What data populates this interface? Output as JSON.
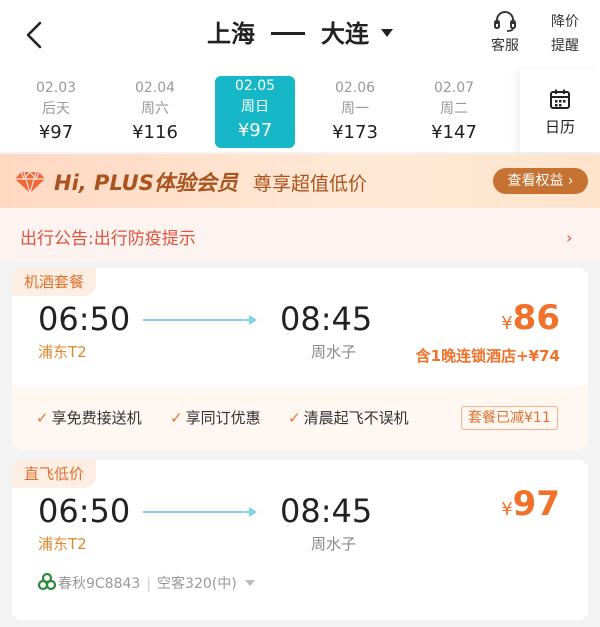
{
  "header": {
    "origin": "上海",
    "destination": "大连",
    "service_label": "客服",
    "alert_line1": "降价",
    "alert_line2": "提醒"
  },
  "dates": [
    {
      "date": "02.03",
      "weekday": "后天",
      "price": "¥97",
      "selected": false
    },
    {
      "date": "02.04",
      "weekday": "周六",
      "price": "¥116",
      "selected": false
    },
    {
      "date": "02.05",
      "weekday": "周日",
      "price": "¥97",
      "selected": true
    },
    {
      "date": "02.06",
      "weekday": "周一",
      "price": "¥173",
      "selected": false
    },
    {
      "date": "02.07",
      "weekday": "周二",
      "price": "¥147",
      "selected": false
    }
  ],
  "calendar_label": "日历",
  "plus_banner": {
    "title": "Hi, PLUS体验会员",
    "subtitle": "尊享超值低价",
    "button": "查看权益 ›"
  },
  "notice": {
    "text": "出行公告:出行防疫提示",
    "chevron": "›"
  },
  "cards": [
    {
      "tag": "机酒套餐",
      "depart_time": "06:50",
      "arrive_time": "08:45",
      "depart_airport": "浦东T2",
      "arrive_airport": "周水子",
      "currency": "¥",
      "price": "86",
      "hotel_note": "含1晚连锁酒店+¥74",
      "perks": [
        "享免费接送机",
        "享同订优惠",
        "清晨起飞不误机"
      ],
      "discount": "套餐已减¥11"
    },
    {
      "tag": "直飞低价",
      "depart_time": "06:50",
      "arrive_time": "08:45",
      "depart_airport": "浦东T2",
      "arrive_airport": "周水子",
      "currency": "¥",
      "price": "97",
      "airline": "春秋9C8843",
      "aircraft": "空客320(中)"
    }
  ],
  "colors": {
    "accent": "#16b8c8",
    "price": "#f2712a",
    "notice": "#e0533c",
    "plus_brown": "#a9531e"
  }
}
